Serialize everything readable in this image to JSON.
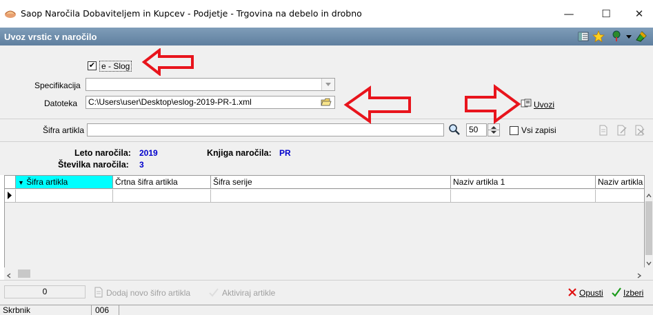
{
  "window": {
    "title": "Saop  Naročila Dobaviteljem in Kupcev - Podjetje - Trgovina na debelo in drobno",
    "minimize": "—",
    "maximize": "☐",
    "close": "✕"
  },
  "header": {
    "title": "Uvoz vrstic v naročilo"
  },
  "form": {
    "eslog_checked": "✔",
    "eslog_label": "e - Slog",
    "specifikacija_label": "Specifikacija",
    "specifikacija_value": "",
    "datoteka_label": "Datoteka",
    "datoteka_value": "C:\\Users\\user\\Desktop\\eslog-2019-PR-1.xml",
    "uvozi_label": "Uvozi"
  },
  "search": {
    "sifra_label": "Šifra artikla",
    "sifra_value": "",
    "count_value": "50",
    "vsi_zapisi_label": "Vsi zapisi"
  },
  "info": {
    "leto_label": "Leto naročila:",
    "leto_value": "2019",
    "knjiga_label": "Knjiga naročila:",
    "knjiga_value": "PR",
    "stevilka_label": "Številka naročila:",
    "stevilka_value": "3"
  },
  "grid": {
    "columns": [
      "Šifra artikla",
      "Črtna šifra artikla",
      "Šifra serije",
      "Naziv artikla 1",
      "Naziv artikla"
    ]
  },
  "bottom": {
    "count": "0",
    "dodaj_label": "Dodaj novo šifro artikla",
    "aktiviraj_label": "Aktiviraj artikle",
    "opusti_label": "Opusti",
    "izberi_label": "Izberi"
  },
  "status": {
    "user": "Skrbnik",
    "code": "006"
  },
  "colors": {
    "accent_blue": "#0000cc",
    "header_band": "#6f8fae",
    "arrow_red": "#e8141c",
    "selected_column": "#00ffff"
  }
}
